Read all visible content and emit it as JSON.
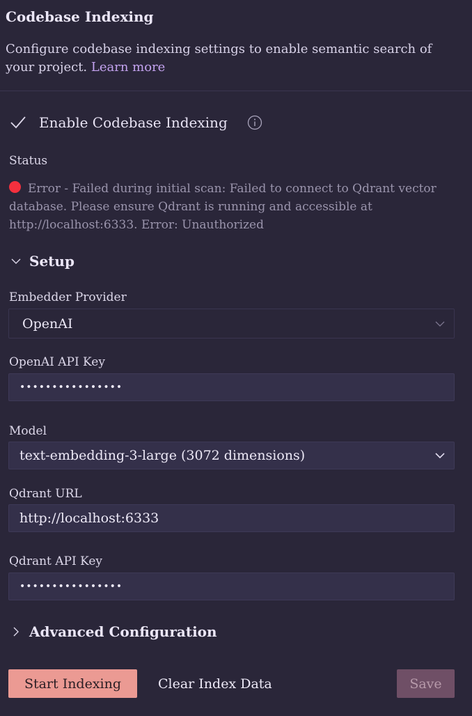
{
  "header": {
    "title": "Codebase Indexing",
    "description": "Configure codebase indexing settings to enable semantic search of your project.",
    "learn_more": "Learn more"
  },
  "enable": {
    "label": "Enable Codebase Indexing",
    "checked": true
  },
  "status": {
    "label": "Status",
    "text": "Error - Failed during initial scan: Failed to connect to Qdrant vector database. Please ensure Qdrant is running and accessible at http://localhost:6333. Error: Unauthorized",
    "color": "#f5303e"
  },
  "setup": {
    "label": "Setup",
    "expanded": true,
    "embedder_provider": {
      "label": "Embedder Provider",
      "value": "OpenAI"
    },
    "openai_api_key": {
      "label": "OpenAI API Key",
      "value": "••••••••••••••••"
    },
    "model": {
      "label": "Model",
      "value": "text-embedding-3-large (3072 dimensions)"
    },
    "qdrant_url": {
      "label": "Qdrant URL",
      "value": "http://localhost:6333"
    },
    "qdrant_api_key": {
      "label": "Qdrant API Key",
      "value": "••••••••••••••••"
    }
  },
  "advanced": {
    "label": "Advanced Configuration",
    "expanded": false
  },
  "actions": {
    "start_indexing": "Start Indexing",
    "clear_index": "Clear Index Data",
    "save": "Save"
  },
  "colors": {
    "background": "#2a2639",
    "accent": "#c4a3f0",
    "primary_button": "#eb9a93",
    "save_button_disabled": "#6f4f66",
    "error": "#f5303e"
  }
}
